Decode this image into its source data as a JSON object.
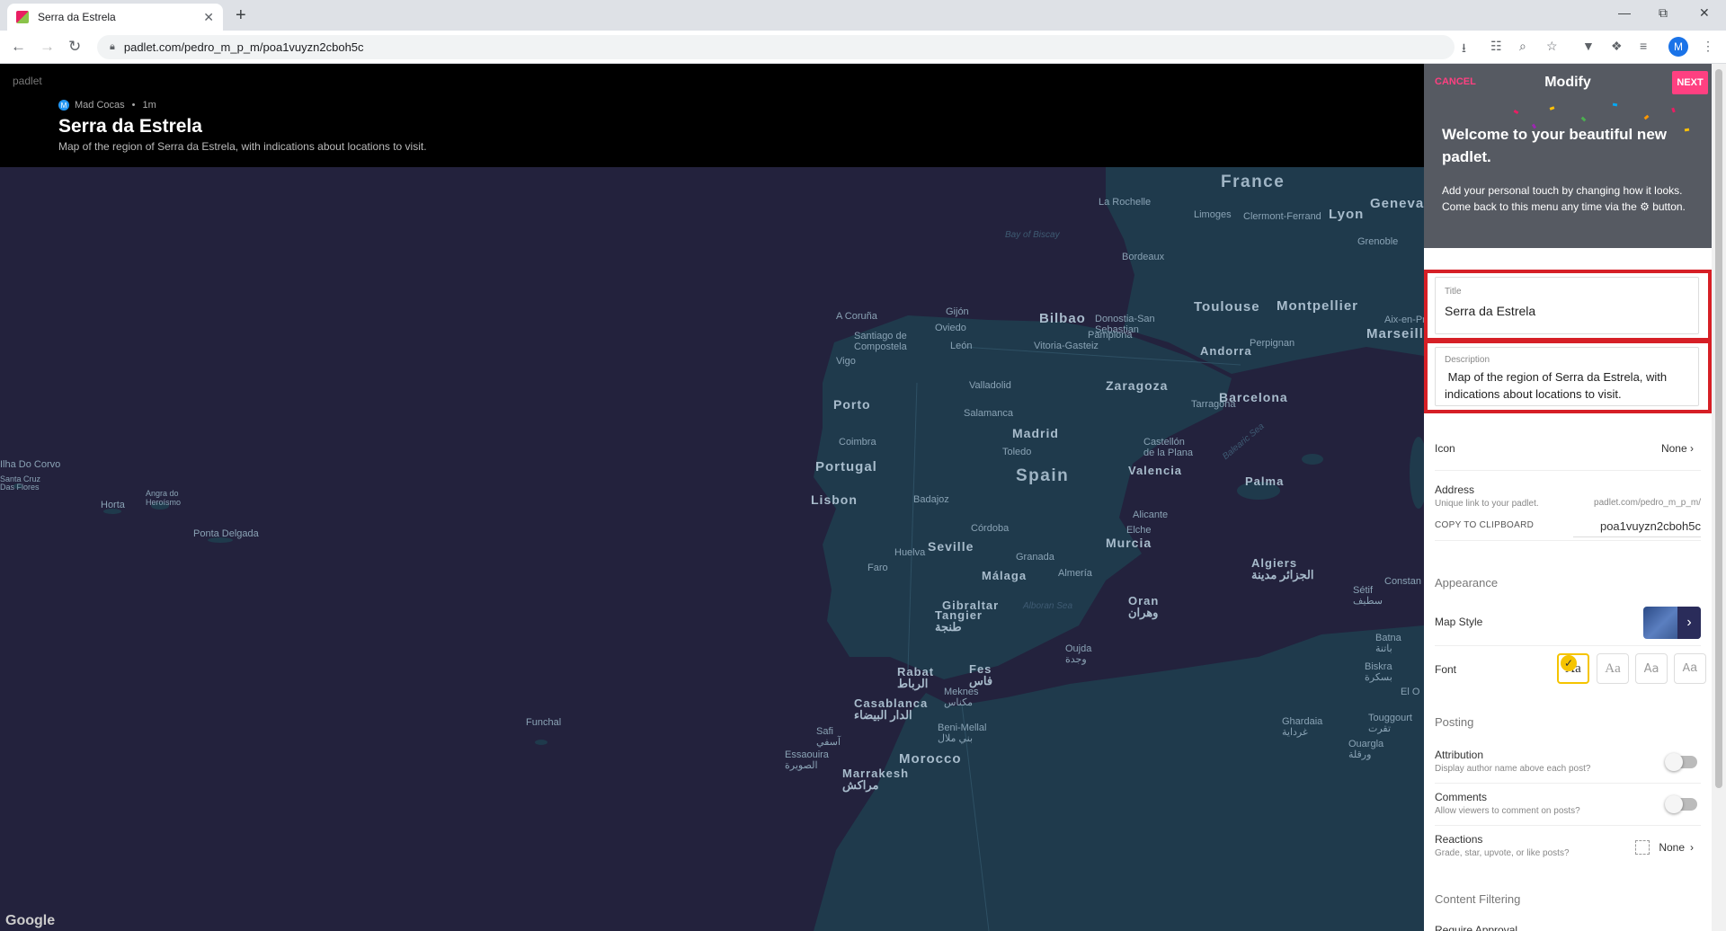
{
  "browser": {
    "tab_title": "Serra da Estrela",
    "tab_close": "✕",
    "new_tab": "+",
    "url": "padlet.com/pedro_m_p_m/poa1vuyzn2cboh5c",
    "profile_initial": "M"
  },
  "header": {
    "brand": "padlet",
    "author_initial": "M",
    "author": "Mad Cocas",
    "time": "1m",
    "title": "Serra da Estrela",
    "description": "Map of the region of Serra da Estrela, with indications about locations to visit."
  },
  "map": {
    "attribution": "Google",
    "labels": {
      "france": "France",
      "spain": "Spain",
      "portugal": "Portugal",
      "morocco": "Morocco",
      "la_rochelle": "La Rochelle",
      "limoges": "Limoges",
      "clermont": "Clermont-Ferrand",
      "lyon": "Lyon",
      "geneva": "Geneva",
      "grenoble": "Grenoble",
      "bay": "Bay of Biscay",
      "bordeaux": "Bordeaux",
      "toulouse": "Toulouse",
      "montpellier": "Montpellier",
      "aix": "Aix-en-Pro",
      "marseille": "Marseille",
      "gijon": "Gijón",
      "acoruna": "A Coruña",
      "oviedo": "Oviedo",
      "bilbao": "Bilbao",
      "donostia": "Donostia-San\nSebastian",
      "santiago": "Santiago de\nCompostela",
      "leon": "León",
      "vitoria": "Vitoria-Gasteiz",
      "pamplona": "Pamplona",
      "perpignan": "Perpignan",
      "andorra": "Andorra",
      "vigo": "Vigo",
      "valladolid": "Valladolid",
      "zaragoza": "Zaragoza",
      "porto": "Porto",
      "salamanca": "Salamanca",
      "tarragona": "Tarragona",
      "barcelona": "Barcelona",
      "madrid": "Madrid",
      "coimbra": "Coimbra",
      "toledo": "Toledo",
      "castellon": "Castellón\nde la Plana",
      "balearic": "Balearic Sea",
      "valencia": "Valencia",
      "palma": "Palma",
      "lisbon": "Lisbon",
      "badajoz": "Badajoz",
      "alicante": "Alicante",
      "elche": "Elche",
      "cordoba": "Córdoba",
      "murcia": "Murcia",
      "seville": "Seville",
      "huelva": "Huelva",
      "granada": "Granada",
      "faro": "Faro",
      "malaga": "Málaga",
      "almeria": "Almería",
      "algiers": "Algiers\nالجزائر مدينة",
      "constan": "Constan",
      "setif": "Sétif\nسطيف",
      "gibraltar": "Gibraltar",
      "alboran": "Alboran Sea",
      "oran": "Oran\nوهران",
      "batna": "Batna\nباتنة",
      "biskra": "Biskra\nبسكرة",
      "tangier": "Tangier\nطنجة",
      "oujda": "Oujda\nوجدة",
      "rabat": "Rabat\nالرباط",
      "fes": "Fes\nفاس",
      "elo": "El O",
      "meknes": "Meknes\nمكناس",
      "casablanca": "Casablanca\nالدار البيضاء",
      "benimellal": "Beni-Mellal\nبني ملال",
      "ghardaia": "Ghardaia\nغرداية",
      "touggourt": "Touggourt\nتقرت",
      "safi": "Safi\nآسفي",
      "ouargla": "Ouargla\nورقلة",
      "essaouira": "Essaouira\nالصويرة",
      "marrakesh": "Marrakesh\nمراكش",
      "funchal": "Funchal",
      "ilhacorvo": "Ilha Do Corvo",
      "santacruz": "Santa Cruz\nDas Flores",
      "angra": "Angra do\nHeroísmo",
      "horta": "Horta",
      "pontadelgada": "Ponta Delgada"
    }
  },
  "panel": {
    "cancel": "CANCEL",
    "heading": "Modify",
    "next": "NEXT",
    "welcome_title": "Welcome to your beautiful new padlet.",
    "welcome_text": "Add your personal touch by changing how it looks. Come back to this menu any time via the ⚙ button.",
    "title_label": "Title",
    "title_value": "Serra da Estrela",
    "description_label": "Description",
    "description_value": " Map of the region of Serra da Estrela, with indications about locations to visit.",
    "icon_label": "Icon",
    "icon_value": "None",
    "address_label": "Address",
    "address_sub": "Unique link to your padlet.",
    "address_prefix": "padlet.com/pedro_m_p_m/",
    "copy_label": "COPY TO CLIPBOARD",
    "address_slug": "poa1vuyzn2cboh5c",
    "appearance": "Appearance",
    "map_style": "Map Style",
    "font_label": "Font",
    "font_options": [
      "Aa",
      "Aa",
      "Aa",
      "Aa"
    ],
    "posting": "Posting",
    "attribution": "Attribution",
    "attribution_sub": "Display author name above each post?",
    "comments": "Comments",
    "comments_sub": "Allow viewers to comment on posts?",
    "reactions": "Reactions",
    "reactions_sub": "Grade, star, upvote, or like posts?",
    "reactions_value": "None",
    "content_filtering": "Content Filtering",
    "require_approval": "Require Approval"
  },
  "colors": {
    "accent": "#ff4081",
    "highlight_border": "#d61f26",
    "map_bg": "#23223d",
    "land": "#1f3a4c"
  }
}
